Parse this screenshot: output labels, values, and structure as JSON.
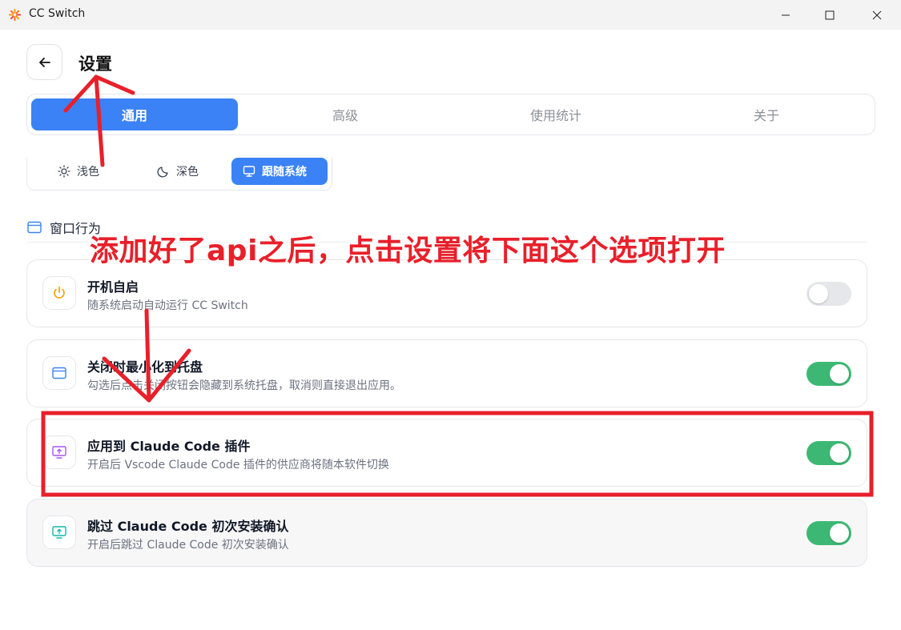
{
  "window": {
    "title": "CC Switch"
  },
  "header": {
    "title": "设置"
  },
  "tabs": [
    {
      "label": "通用",
      "active": true
    },
    {
      "label": "高级",
      "active": false
    },
    {
      "label": "使用统计",
      "active": false
    },
    {
      "label": "关于",
      "active": false
    }
  ],
  "theme": {
    "options": [
      {
        "label": "浅色",
        "icon": "sun-icon",
        "active": false
      },
      {
        "label": "深色",
        "icon": "moon-icon",
        "active": false
      },
      {
        "label": "跟随系统",
        "icon": "monitor-icon",
        "active": true
      }
    ]
  },
  "section": {
    "title": "窗口行为"
  },
  "settings": [
    {
      "title": "开机自启",
      "description": "随系统启动自动运行 CC Switch",
      "icon": "power-icon",
      "enabled": false
    },
    {
      "title": "关闭时最小化到托盘",
      "description": "勾选后点击关闭按钮会隐藏到系统托盘，取消则直接退出应用。",
      "icon": "window-icon",
      "enabled": true
    },
    {
      "title": "应用到 Claude Code 插件",
      "description": "开启后 Vscode Claude Code 插件的供应商将随本软件切换",
      "icon": "monitor-upload-icon",
      "enabled": true
    },
    {
      "title": "跳过 Claude Code 初次安装确认",
      "description": "开启后跳过 Claude Code 初次安装确认",
      "icon": "monitor-upload-icon",
      "enabled": true
    }
  ],
  "annotation": {
    "text": "添加好了api之后，点击设置将下面这个选项打开",
    "color": "#e8202a"
  },
  "colors": {
    "accent": "#3b82f6",
    "toggle_on": "#3db874"
  }
}
